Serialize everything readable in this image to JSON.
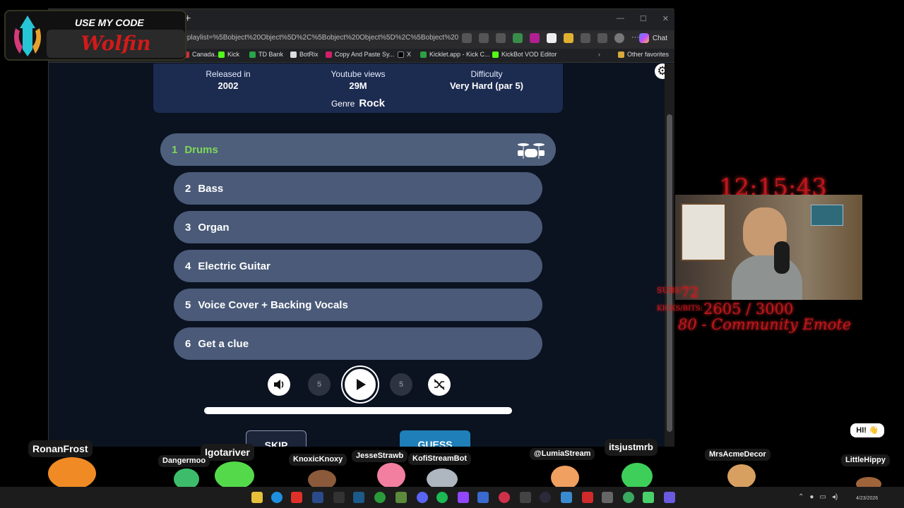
{
  "browser": {
    "url": "=playlist=%5Bobject%20Object%5D%2C%5Bobject%20Object%5D%2C%5Bobject%20Object%5D%2C%5Bobject%20Obj...",
    "chat_label": "Chat",
    "bookmarks": [
      "Canada...",
      "Kick",
      "TD Bank",
      "BotRix",
      "Copy And Paste Sy...",
      "X",
      "Kicklet.app - Kick C...",
      "KickBot VOD Editor"
    ],
    "other_favorites": "Other favorites"
  },
  "song_info": {
    "released_label": "Released in",
    "released_value": "2002",
    "views_label": "Youtube views",
    "views_value": "29M",
    "difficulty_label": "Difficulty",
    "difficulty_value": "Very Hard (par 5)",
    "genre_label": "Genre",
    "genre_value": "Rock"
  },
  "tracks": [
    {
      "num": "1",
      "label": "Drums",
      "active": true
    },
    {
      "num": "2",
      "label": "Bass"
    },
    {
      "num": "3",
      "label": "Organ"
    },
    {
      "num": "4",
      "label": "Electric Guitar"
    },
    {
      "num": "5",
      "label": "Voice Cover + Backing Vocals"
    },
    {
      "num": "6",
      "label": "Get a clue"
    }
  ],
  "controls": {
    "rewind_label": "5",
    "forward_label": "5",
    "skip_label": "SKIP",
    "guess_label": "GUESS",
    "progress": 1.0
  },
  "overlay": {
    "code_top": "USE MY CODE",
    "code_name": "Wolfin",
    "clock": "12:15:43",
    "subs_label": "SUBS:",
    "subs_value": "72",
    "kicks_label": "KICKS/BITS:",
    "kicks_value": "2605 / 3000",
    "goal_text": "80 - Community Emote",
    "hi_text": "HI! 👋"
  },
  "chatters": [
    "RonanFrost",
    "lgotariver",
    "Dangermoo",
    "KnoxicKnoxy",
    "JesseStrawb",
    "KofiStreamBot",
    "@LumiaStream",
    "itsjustmrb",
    "MrsAcmeDecor",
    "LittleHippy"
  ],
  "taskbar": {
    "date": "4/23/2026"
  },
  "colors": {
    "accent_green": "#7ed957",
    "track_bg": "#4a5a78",
    "info_bg": "#1c2b50",
    "overlay_red": "#c0151b",
    "guess_blue": "#1f7fb8"
  }
}
